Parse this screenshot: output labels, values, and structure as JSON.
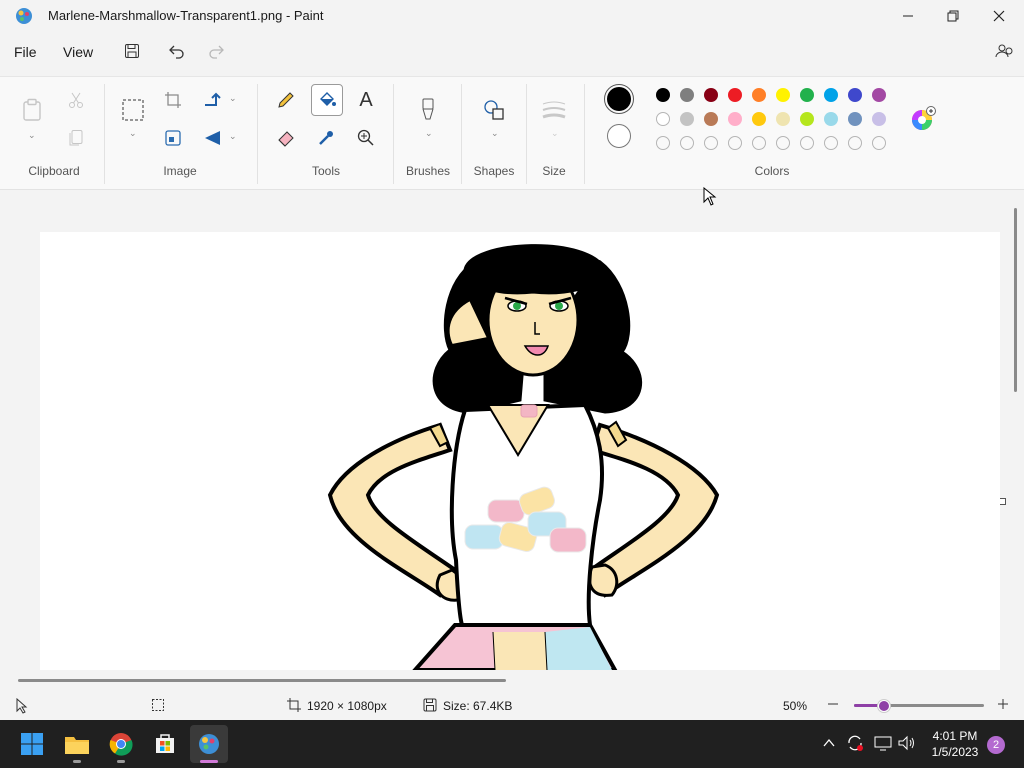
{
  "window": {
    "title": "Marlene-Marshmallow-Transparent1.png - Paint"
  },
  "menu": {
    "file": "File",
    "view": "View"
  },
  "ribbon": {
    "groups": {
      "clipboard": "Clipboard",
      "image": "Image",
      "tools": "Tools",
      "brushes": "Brushes",
      "shapes": "Shapes",
      "size": "Size",
      "colors": "Colors"
    },
    "text_tool_glyph": "A",
    "primary_color": "#000000",
    "secondary_color": "#ffffff",
    "palette_row1": [
      "#000000",
      "#7f7f7f",
      "#880015",
      "#ed1c24",
      "#ff7f27",
      "#fff200",
      "#22b14c",
      "#00a2e8",
      "#3f48cc",
      "#a349a4"
    ],
    "palette_row2": [
      "#ffffff",
      "#c3c3c3",
      "#b97a57",
      "#ffaec9",
      "#ffc90e",
      "#efe4b0",
      "#b5e61d",
      "#99d9ea",
      "#7092be",
      "#c8bfe7"
    ]
  },
  "status": {
    "dimensions": "1920 × 1080px",
    "size": "Size: 67.4KB",
    "zoom": "50%",
    "zoom_level": 0.5
  },
  "taskbar": {
    "time": "4:01 PM",
    "date": "1/5/2023",
    "notifications": "2"
  }
}
